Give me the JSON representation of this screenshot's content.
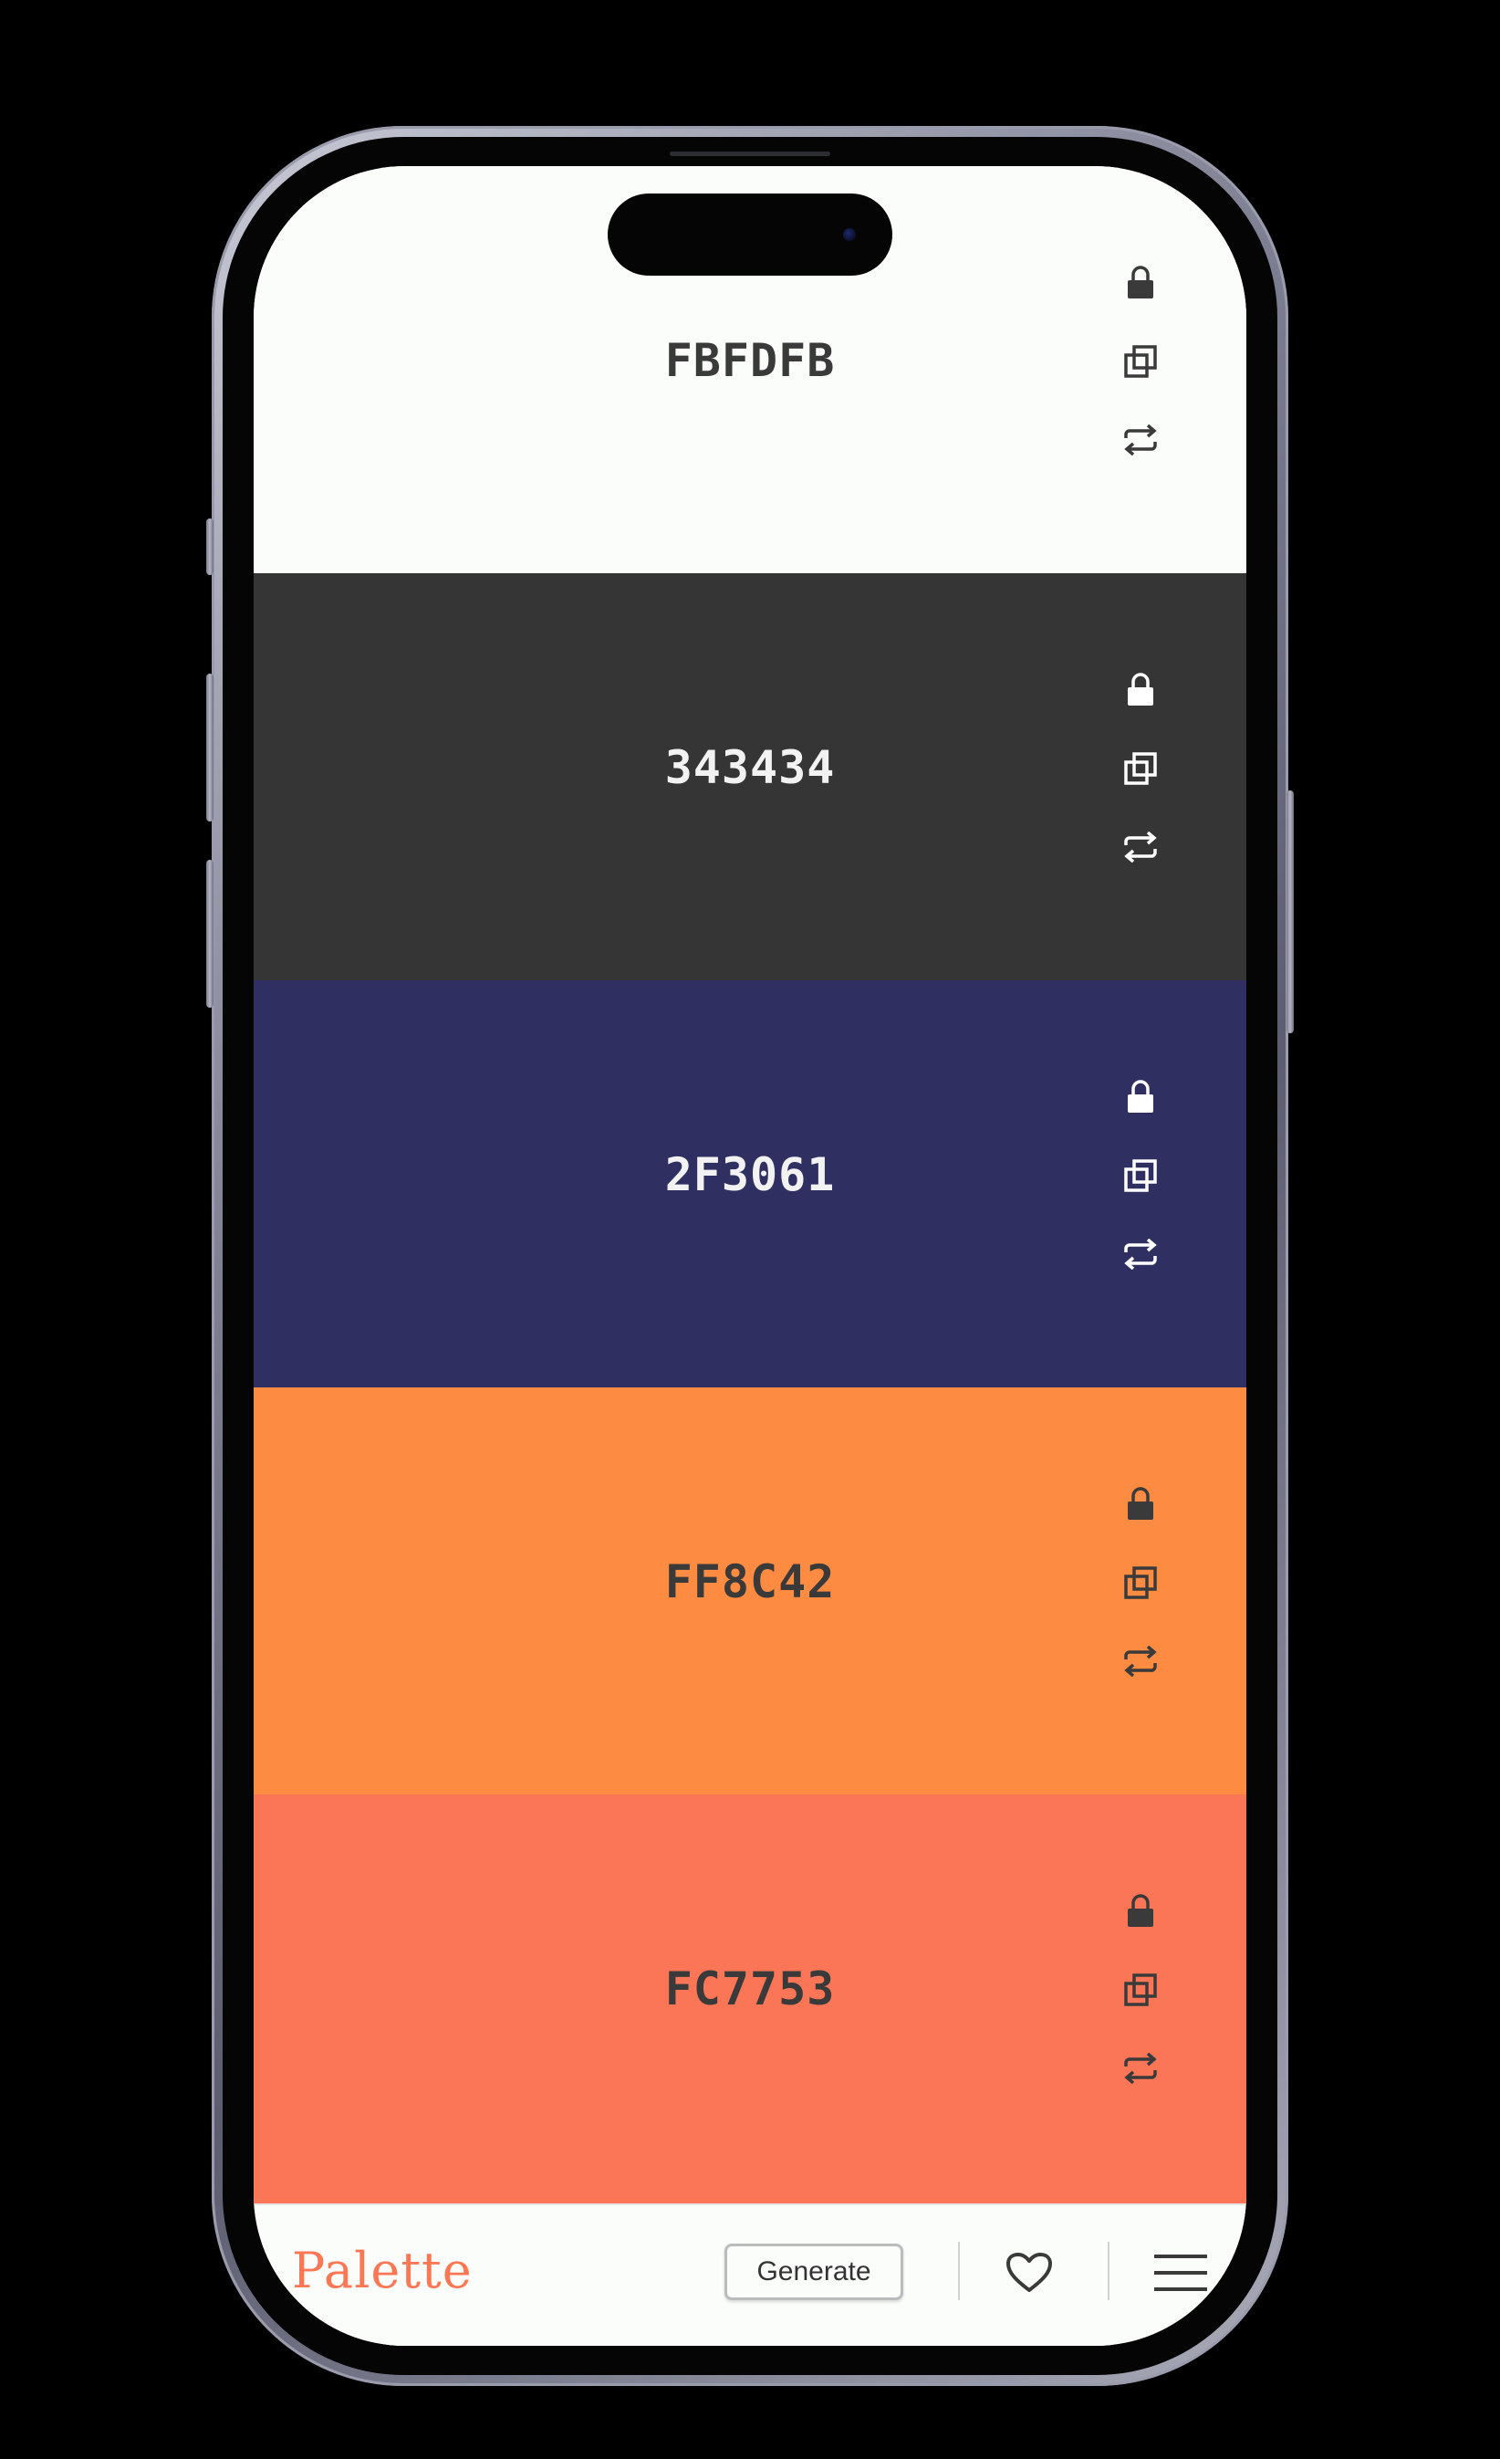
{
  "app": {
    "brand": "Palette"
  },
  "swatches": [
    {
      "hex": "FBFDFB",
      "background": "#fbfdfb",
      "text_color": "#3a3a3a",
      "icon_color": "#3a3a3a"
    },
    {
      "hex": "343434",
      "background": "#353535",
      "text_color": "#f2f2f2",
      "icon_color": "#ffffff"
    },
    {
      "hex": "2F3061",
      "background": "#2f3061",
      "text_color": "#f2f2f2",
      "icon_color": "#ffffff"
    },
    {
      "hex": "FF8C42",
      "background": "#fd8b42",
      "text_color": "#3a3a3a",
      "icon_color": "#3a3a3a"
    },
    {
      "hex": "FC7753",
      "background": "#fa7656",
      "text_color": "#3a3a3a",
      "icon_color": "#3a3a3a"
    }
  ],
  "icons": {
    "lock": "lock-icon",
    "copy": "copy-icon",
    "swap": "swap-icon"
  },
  "toolbar": {
    "generate_label": "Generate",
    "favorite_icon": "heart-icon",
    "menu_icon": "hamburger-menu-icon"
  },
  "colors": {
    "brand": "#fc7753",
    "bar_background": "#fbfdfb"
  }
}
